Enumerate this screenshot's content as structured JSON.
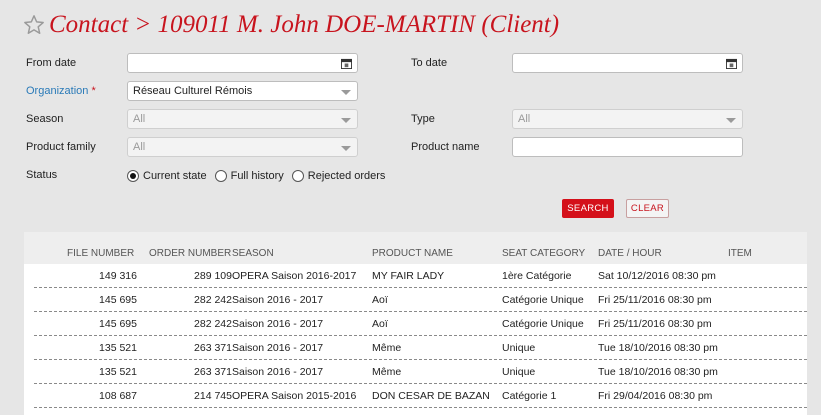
{
  "header": {
    "title": "Contact > 109011 M. John DOE-MARTIN (Client)"
  },
  "form": {
    "from_date": {
      "label": "From date",
      "value": ""
    },
    "to_date": {
      "label": "To date",
      "value": ""
    },
    "organization": {
      "label": "Organization",
      "required_mark": "*",
      "value": "Réseau Culturel Rémois"
    },
    "season": {
      "label": "Season",
      "value": "All"
    },
    "type": {
      "label": "Type",
      "value": "All"
    },
    "product_family": {
      "label": "Product family",
      "value": "All"
    },
    "product_name": {
      "label": "Product name",
      "value": ""
    },
    "status": {
      "label": "Status",
      "options": [
        {
          "label": "Current state",
          "selected": true
        },
        {
          "label": "Full history",
          "selected": false
        },
        {
          "label": "Rejected orders",
          "selected": false
        }
      ]
    },
    "search_label": "SEARCH",
    "clear_label": "CLEAR"
  },
  "table": {
    "columns": [
      "FILE NUMBER",
      "ORDER NUMBER",
      "SEASON",
      "PRODUCT NAME",
      "SEAT CATEGORY",
      "DATE / HOUR",
      "ITEM"
    ],
    "rows": [
      {
        "file": "149 316",
        "order": "289 109",
        "season": "OPERA Saison 2016-2017",
        "product": "MY FAIR LADY",
        "seat": "1ère Catégorie",
        "date": "Sat 10/12/2016 08:30 pm"
      },
      {
        "file": "145 695",
        "order": "282 242",
        "season": "Saison 2016 - 2017",
        "product": "Aoï",
        "seat": "Catégorie Unique",
        "date": "Fri 25/11/2016 08:30 pm"
      },
      {
        "file": "145 695",
        "order": "282 242",
        "season": "Saison 2016 - 2017",
        "product": "Aoï",
        "seat": "Catégorie Unique",
        "date": "Fri 25/11/2016 08:30 pm"
      },
      {
        "file": "135 521",
        "order": "263 371",
        "season": "Saison 2016 - 2017",
        "product": "Même",
        "seat": "Unique",
        "date": "Tue 18/10/2016 08:30 pm"
      },
      {
        "file": "135 521",
        "order": "263 371",
        "season": "Saison 2016 - 2017",
        "product": "Même",
        "seat": "Unique",
        "date": "Tue 18/10/2016 08:30 pm"
      },
      {
        "file": "108 687",
        "order": "214 745",
        "season": "OPERA Saison 2015-2016",
        "product": "DON CESAR DE BAZAN",
        "seat": "Catégorie 1",
        "date": "Fri 29/04/2016 08:30 pm"
      }
    ]
  },
  "icons": {
    "favorite": "star-outline-icon",
    "calendar": "calendar-icon",
    "dropdown": "chevron-down-icon"
  },
  "colors": {
    "accent": "#c8141e",
    "label_link": "#2a7ab8"
  }
}
